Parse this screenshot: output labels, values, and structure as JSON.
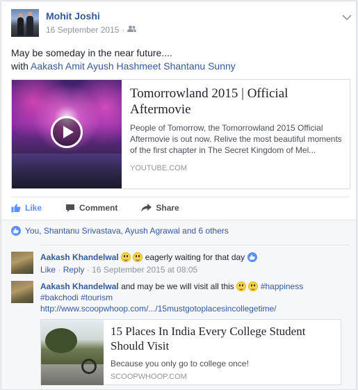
{
  "post": {
    "author": "Mohit Joshi",
    "date": "16 September 2015",
    "separator": "·",
    "status": "May be someday in the near future....",
    "with_label": "with",
    "tagged": [
      "Aakash",
      "Amit",
      "Ayush",
      "Hashmeet",
      "Shantanu",
      "Sunny"
    ]
  },
  "link": {
    "title": "Tomorrowland 2015 | Official Aftermovie",
    "description": "People of Tomorrow, the Tomorrowland 2015 Official Aftermovie is out now. Relive the most beautiful moments of the first chapter in The Secret Kingdom of Mel...",
    "domain": "YOUTUBE.COM"
  },
  "actions": {
    "like": "Like",
    "comment": "Comment",
    "share": "Share"
  },
  "likes_summary": "You, Shantanu Srivastava, Ayush Agrawal and 6 others",
  "comments": [
    {
      "author": "Aakash Khandelwal",
      "text": "eagerly waiting for that day",
      "like": "Like",
      "reply": "Reply",
      "dot": "·",
      "timestamp": "16 September 2015 at 08:05"
    },
    {
      "author": "Aakash Khandelwal",
      "text": "and may be we will visit all this",
      "hashtags": [
        "#happiness",
        "#bakchodi",
        "#tourism"
      ],
      "url": "http://www.scoopwhoop.com/.../15mustgotoplacesincollegetime/"
    }
  ],
  "link2": {
    "title": "15 Places In India Every College Student Should Visit",
    "description": "Because you only go to college once!",
    "domain": "SCOOPWHOOP.COM"
  },
  "colors": {
    "link_blue": "#365899",
    "like_blue": "#5890ff",
    "meta_grey": "#90949c",
    "background": "#e9ebee"
  }
}
